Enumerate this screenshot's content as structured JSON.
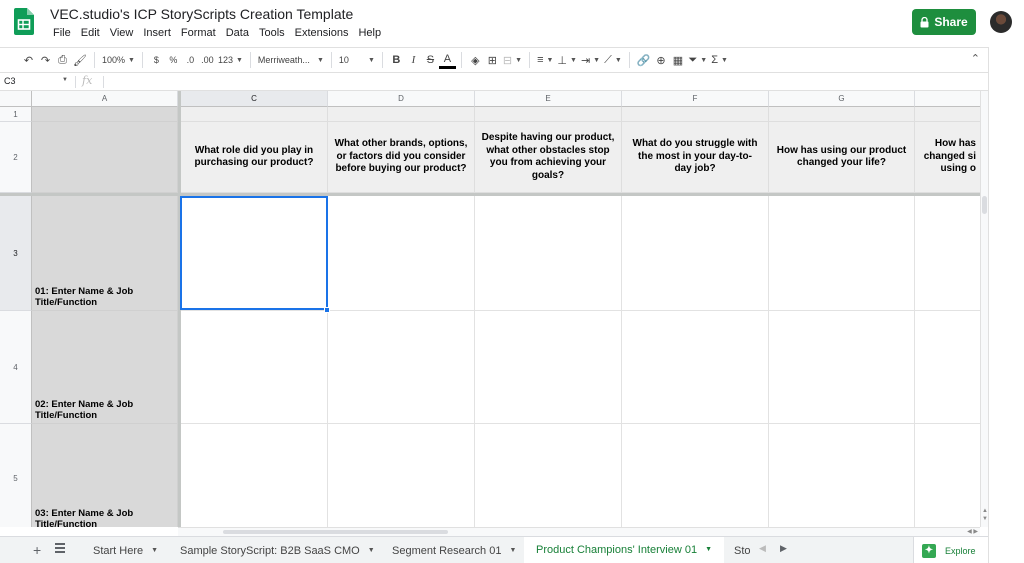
{
  "header": {
    "title": "VEC.studio's ICP StoryScripts Creation Template",
    "share_label": "Share",
    "menu": [
      "File",
      "Edit",
      "View",
      "Insert",
      "Format",
      "Data",
      "Tools",
      "Extensions",
      "Help"
    ]
  },
  "toolbar": {
    "zoom": "100%",
    "currency": "$",
    "percent": "%",
    "decrease_decimals": ".0",
    "increase_decimals": ".00",
    "more_formats": "123",
    "font": "Merriweath...",
    "font_size": "10",
    "bold": "B",
    "italic": "I",
    "strikethrough": "S",
    "text_color": "A",
    "functions": "Σ"
  },
  "formula_bar": {
    "cell_ref": "C3",
    "fx": "fx"
  },
  "grid": {
    "columns": [
      "A",
      "C",
      "D",
      "E",
      "F",
      "G"
    ],
    "rows": [
      "1",
      "2",
      "3",
      "4",
      "5"
    ],
    "questions": [
      "What role did you play in purchasing our product?",
      "What other brands, options, or factors did you consider before buying our product?",
      "Despite having our product, what other obstacles stop you from achieving your goals?",
      "What do you struggle with the most in your day-to-day job?",
      "How has using our product changed your life?",
      "How has changed si using o"
    ],
    "names": [
      "01: Enter Name & Job Title/Function",
      "02: Enter Name & Job Title/Function",
      "03: Enter Name & Job Title/Function"
    ]
  },
  "sheet_tabs": {
    "tabs": [
      "Start Here",
      "Sample StoryScript: B2B SaaS CMO",
      "Segment Research 01",
      "Product Champions' Interview 01",
      "Sto"
    ],
    "active_index": 3,
    "explore_label": "Explore"
  },
  "colors": {
    "share_green": "#1e8e3e",
    "active_tab_green": "#188038",
    "selection_blue": "#1a73e8",
    "name_cell_grey": "#d9d9d9",
    "question_cell_grey": "#efefef"
  }
}
